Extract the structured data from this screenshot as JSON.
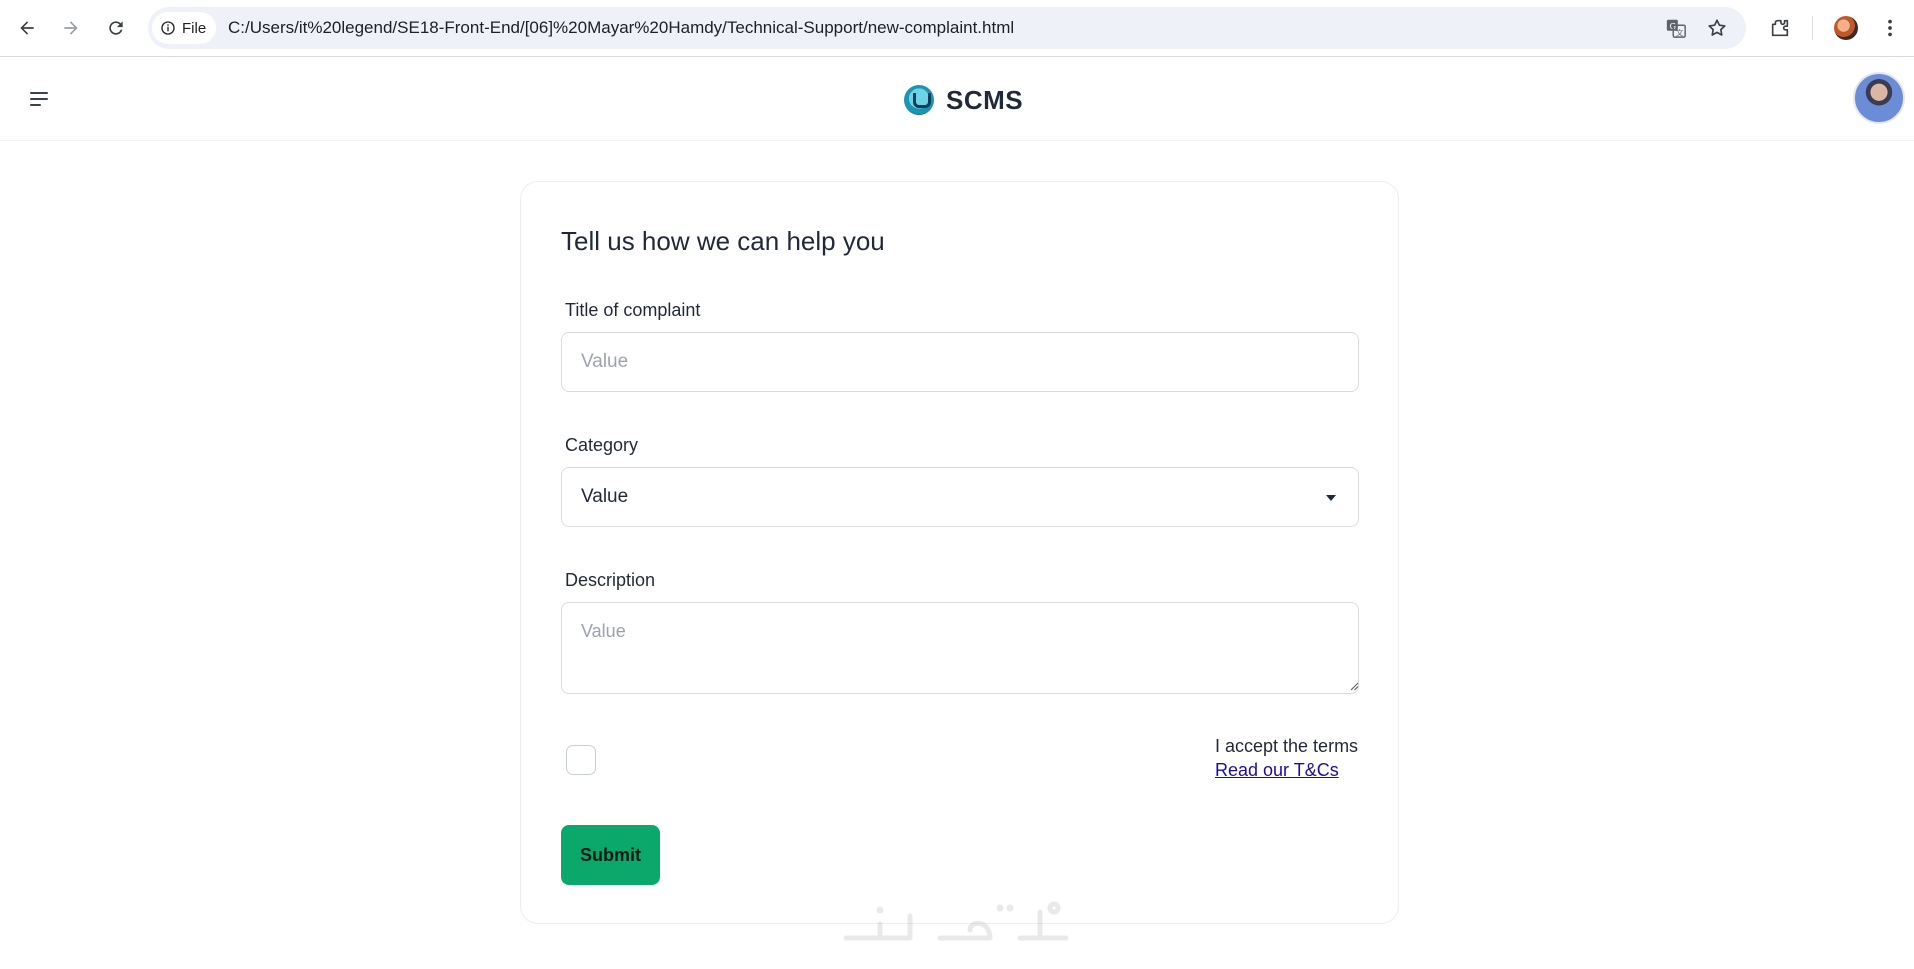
{
  "browser": {
    "file_chip_label": "File",
    "url": "C:/Users/it%20legend/SE18-Front-End/[06]%20Mayar%20Hamdy/Technical-Support/new-complaint.html",
    "icons": [
      "back-icon",
      "forward-icon",
      "reload-icon",
      "info-icon",
      "translate-icon",
      "star-icon",
      "extensions-icon",
      "more-icon"
    ]
  },
  "header": {
    "brand_name": "SCMS",
    "menu_icon": "menu-icon",
    "avatar": "user-avatar"
  },
  "form": {
    "title": "Tell us how we can help you",
    "title_field": {
      "label": "Title of complaint",
      "placeholder": "Value",
      "value": ""
    },
    "category_field": {
      "label": "Category",
      "selected": "Value"
    },
    "description_field": {
      "label": "Description",
      "placeholder": "Value",
      "value": ""
    },
    "terms": {
      "checked": false,
      "label": "I accept the terms",
      "link_text": "Read our T&Cs"
    },
    "submit_label": "Submit"
  },
  "colors": {
    "submit_bg": "#0aa86b",
    "link": "#1a0dab",
    "border": "#d9dce1"
  }
}
